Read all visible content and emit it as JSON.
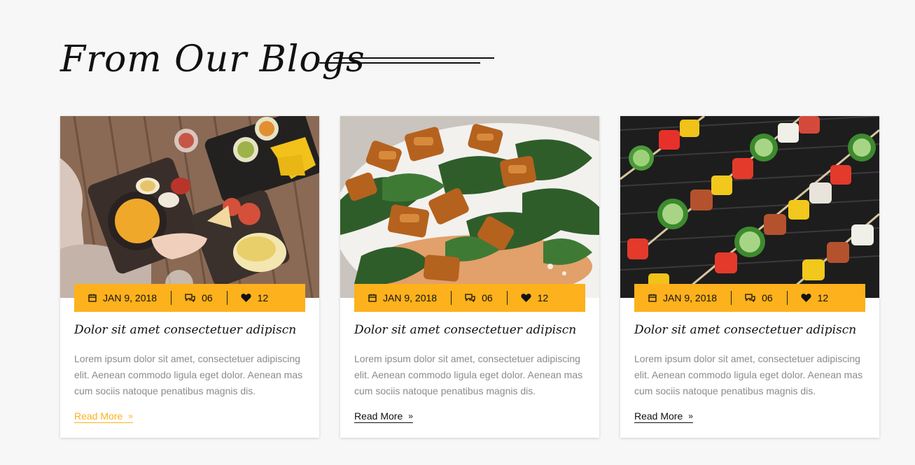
{
  "section": {
    "title": "From Our Blogs"
  },
  "colors": {
    "accent": "#fdb11c",
    "text_dark": "#111111",
    "text_muted": "#8b8b8b",
    "background": "#f7f7f7"
  },
  "icons": {
    "date": "calendar-icon",
    "comments": "comments-icon",
    "likes": "heart-icon",
    "read_more": "double-chevron-right-icon"
  },
  "posts": [
    {
      "image": "food-table-photo",
      "date": "JAN 9, 2018",
      "comments": "06",
      "likes": "12",
      "title": "Dolor sit amet consectetuer adipiscn",
      "excerpt": "Lorem ipsum dolor sit amet, consectetuer adipiscing elit. Aenean commodo ligula eget dolor. Aenean mas cum sociis natoque penatibus magnis dis.",
      "read_more": "Read More",
      "read_more_chevron": "»"
    },
    {
      "image": "chicken-salad-photo",
      "date": "JAN 9, 2018",
      "comments": "06",
      "likes": "12",
      "title": "Dolor sit amet consectetuer adipiscn",
      "excerpt": "Lorem ipsum dolor sit amet, consectetuer adipiscing elit. Aenean commodo ligula eget dolor. Aenean mas cum sociis natoque penatibus magnis dis.",
      "read_more": "Read More",
      "read_more_chevron": "»"
    },
    {
      "image": "kebab-skewers-photo",
      "date": "JAN 9, 2018",
      "comments": "06",
      "likes": "12",
      "title": "Dolor sit amet consectetuer adipiscn",
      "excerpt": "Lorem ipsum dolor sit amet, consectetuer adipiscing elit. Aenean commodo ligula eget dolor. Aenean mas cum sociis natoque penatibus magnis dis.",
      "read_more": "Read More",
      "read_more_chevron": "»"
    }
  ]
}
